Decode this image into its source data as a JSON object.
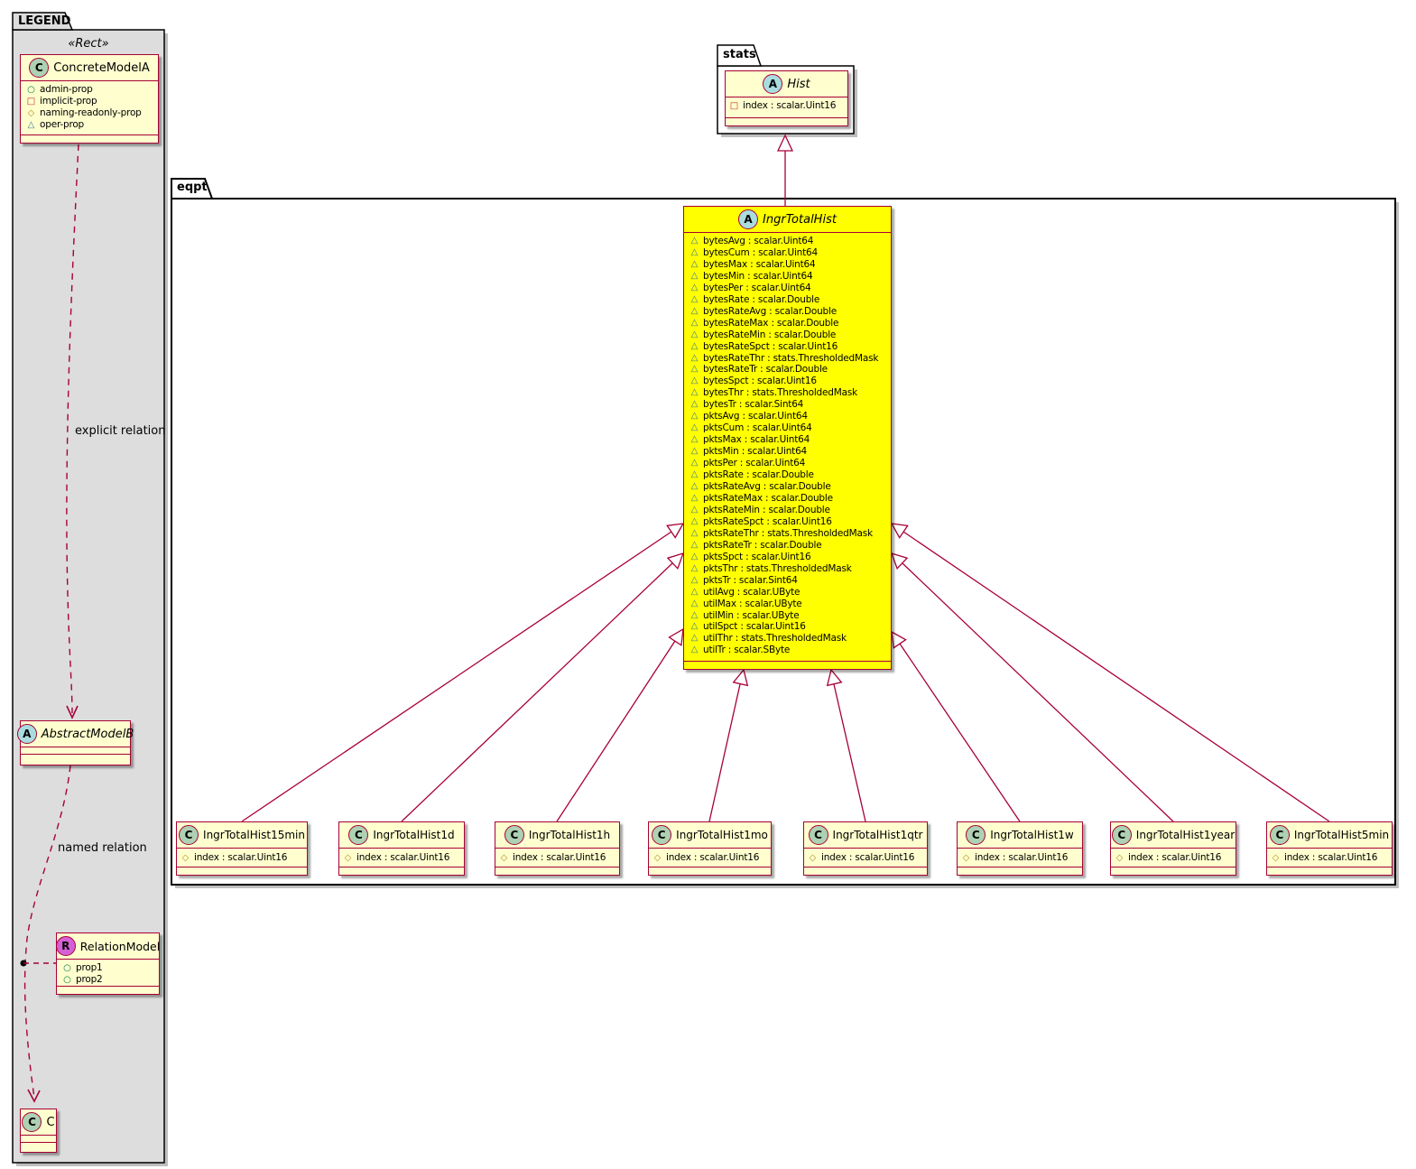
{
  "icons": {
    "public_circle_glyph": "○",
    "private_square_glyph": "□",
    "protected_diamond_glyph": "◇",
    "package_triangle_glyph": "△"
  },
  "colors": {
    "class_border": "#A80036",
    "class_background": "#FEFECE",
    "highlight_background": "#FFFF00",
    "legend_package_background": "#DDDDDD",
    "spot_class_circle": "#ADD1B2",
    "spot_abstract_circle": "#A9DCDF",
    "spot_relation_circle": "#D560D5",
    "icon_public": "#038048",
    "icon_private": "#C82930",
    "icon_protected": "#B38D22",
    "icon_package": "#3A769D",
    "relation_line": "#A80036"
  },
  "legend": {
    "tab": "LEGEND",
    "stereotype": "«Rect»",
    "concrete_model": {
      "name": "ConcreteModelA",
      "type_letter": "C",
      "props": [
        "admin-prop",
        "implicit-prop",
        "naming-readonly-prop",
        "oper-prop"
      ]
    },
    "abstract_model": {
      "name": "AbstractModelB",
      "type_letter": "A"
    },
    "relation_model": {
      "name": "RelationModel",
      "type_letter": "R",
      "props": [
        "prop1",
        "prop2"
      ]
    },
    "c_class": {
      "name": "C",
      "type_letter": "C"
    },
    "labels": {
      "explicit": "explicit relation",
      "named": "named relation"
    }
  },
  "stats_package": {
    "tab": "stats",
    "hist": {
      "name": "Hist",
      "type_letter": "A",
      "prop": "index : scalar.Uint16"
    }
  },
  "eqpt_package": {
    "tab": "eqpt",
    "ingr_total_hist": {
      "name": "IngrTotalHist",
      "type_letter": "A",
      "props": [
        "bytesAvg : scalar.Uint64",
        "bytesCum : scalar.Uint64",
        "bytesMax : scalar.Uint64",
        "bytesMin : scalar.Uint64",
        "bytesPer : scalar.Uint64",
        "bytesRate : scalar.Double",
        "bytesRateAvg : scalar.Double",
        "bytesRateMax : scalar.Double",
        "bytesRateMin : scalar.Double",
        "bytesRateSpct : scalar.Uint16",
        "bytesRateThr : stats.ThresholdedMask",
        "bytesRateTr : scalar.Double",
        "bytesSpct : scalar.Uint16",
        "bytesThr : stats.ThresholdedMask",
        "bytesTr : scalar.Sint64",
        "pktsAvg : scalar.Uint64",
        "pktsCum : scalar.Uint64",
        "pktsMax : scalar.Uint64",
        "pktsMin : scalar.Uint64",
        "pktsPer : scalar.Uint64",
        "pktsRate : scalar.Double",
        "pktsRateAvg : scalar.Double",
        "pktsRateMax : scalar.Double",
        "pktsRateMin : scalar.Double",
        "pktsRateSpct : scalar.Uint16",
        "pktsRateThr : stats.ThresholdedMask",
        "pktsRateTr : scalar.Double",
        "pktsSpct : scalar.Uint16",
        "pktsThr : stats.ThresholdedMask",
        "pktsTr : scalar.Sint64",
        "utilAvg : scalar.UByte",
        "utilMax : scalar.UByte",
        "utilMin : scalar.UByte",
        "utilSpct : scalar.Uint16",
        "utilThr : stats.ThresholdedMask",
        "utilTr : scalar.SByte"
      ]
    },
    "subclasses": [
      {
        "name": "IngrTotalHist15min",
        "type_letter": "C",
        "prop": "index : scalar.Uint16"
      },
      {
        "name": "IngrTotalHist1d",
        "type_letter": "C",
        "prop": "index : scalar.Uint16"
      },
      {
        "name": "IngrTotalHist1h",
        "type_letter": "C",
        "prop": "index : scalar.Uint16"
      },
      {
        "name": "IngrTotalHist1mo",
        "type_letter": "C",
        "prop": "index : scalar.Uint16"
      },
      {
        "name": "IngrTotalHist1qtr",
        "type_letter": "C",
        "prop": "index : scalar.Uint16"
      },
      {
        "name": "IngrTotalHist1w",
        "type_letter": "C",
        "prop": "index : scalar.Uint16"
      },
      {
        "name": "IngrTotalHist1year",
        "type_letter": "C",
        "prop": "index : scalar.Uint16"
      },
      {
        "name": "IngrTotalHist5min",
        "type_letter": "C",
        "prop": "index : scalar.Uint16"
      }
    ]
  }
}
